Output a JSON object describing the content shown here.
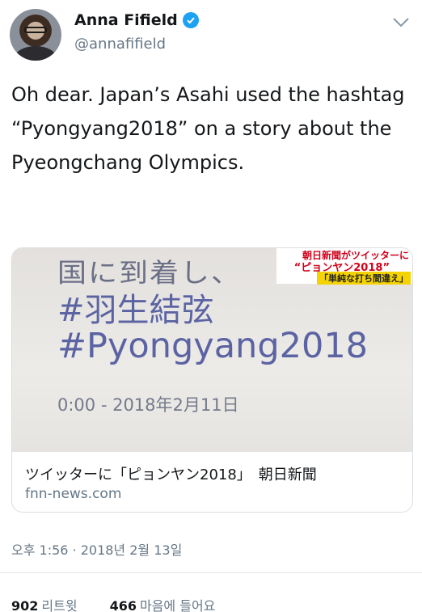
{
  "header": {
    "display_name": "Anna Fifield",
    "handle": "@annafifield",
    "avatar_icon": "avatar",
    "verified_icon": "verified-badge-icon",
    "menu_icon": "chevron-down-icon"
  },
  "tweet": {
    "text": "Oh dear. Japan’s Asahi used the hashtag “Pyongyang2018” on a story about the Pyeongchang Olympics."
  },
  "card": {
    "media": {
      "top_text": "国に到着し、",
      "hashtag1": "#羽生結弦",
      "hashtag2": "#Pyongyang2018",
      "time_text": "0:00 - 2018年2月11日",
      "tv_caption_line1": "朝日新聞がツイッターに",
      "tv_caption_line2": "“ピョンヤン2018”",
      "tv_caption_line3": "「単純な打ち間違え」"
    },
    "title": "ツイッターに「ピョンヤン2018」　朝日新聞",
    "domain": "fnn-news.com"
  },
  "timestamp": "오후 1:56 · 2018년 2월 13일",
  "stats": {
    "retweets_count": "902",
    "retweets_label": "리트윗",
    "likes_count": "466",
    "likes_label": "마음에 들어요"
  },
  "colors": {
    "accent": "#1da1f2",
    "secondary_text": "#657786"
  }
}
